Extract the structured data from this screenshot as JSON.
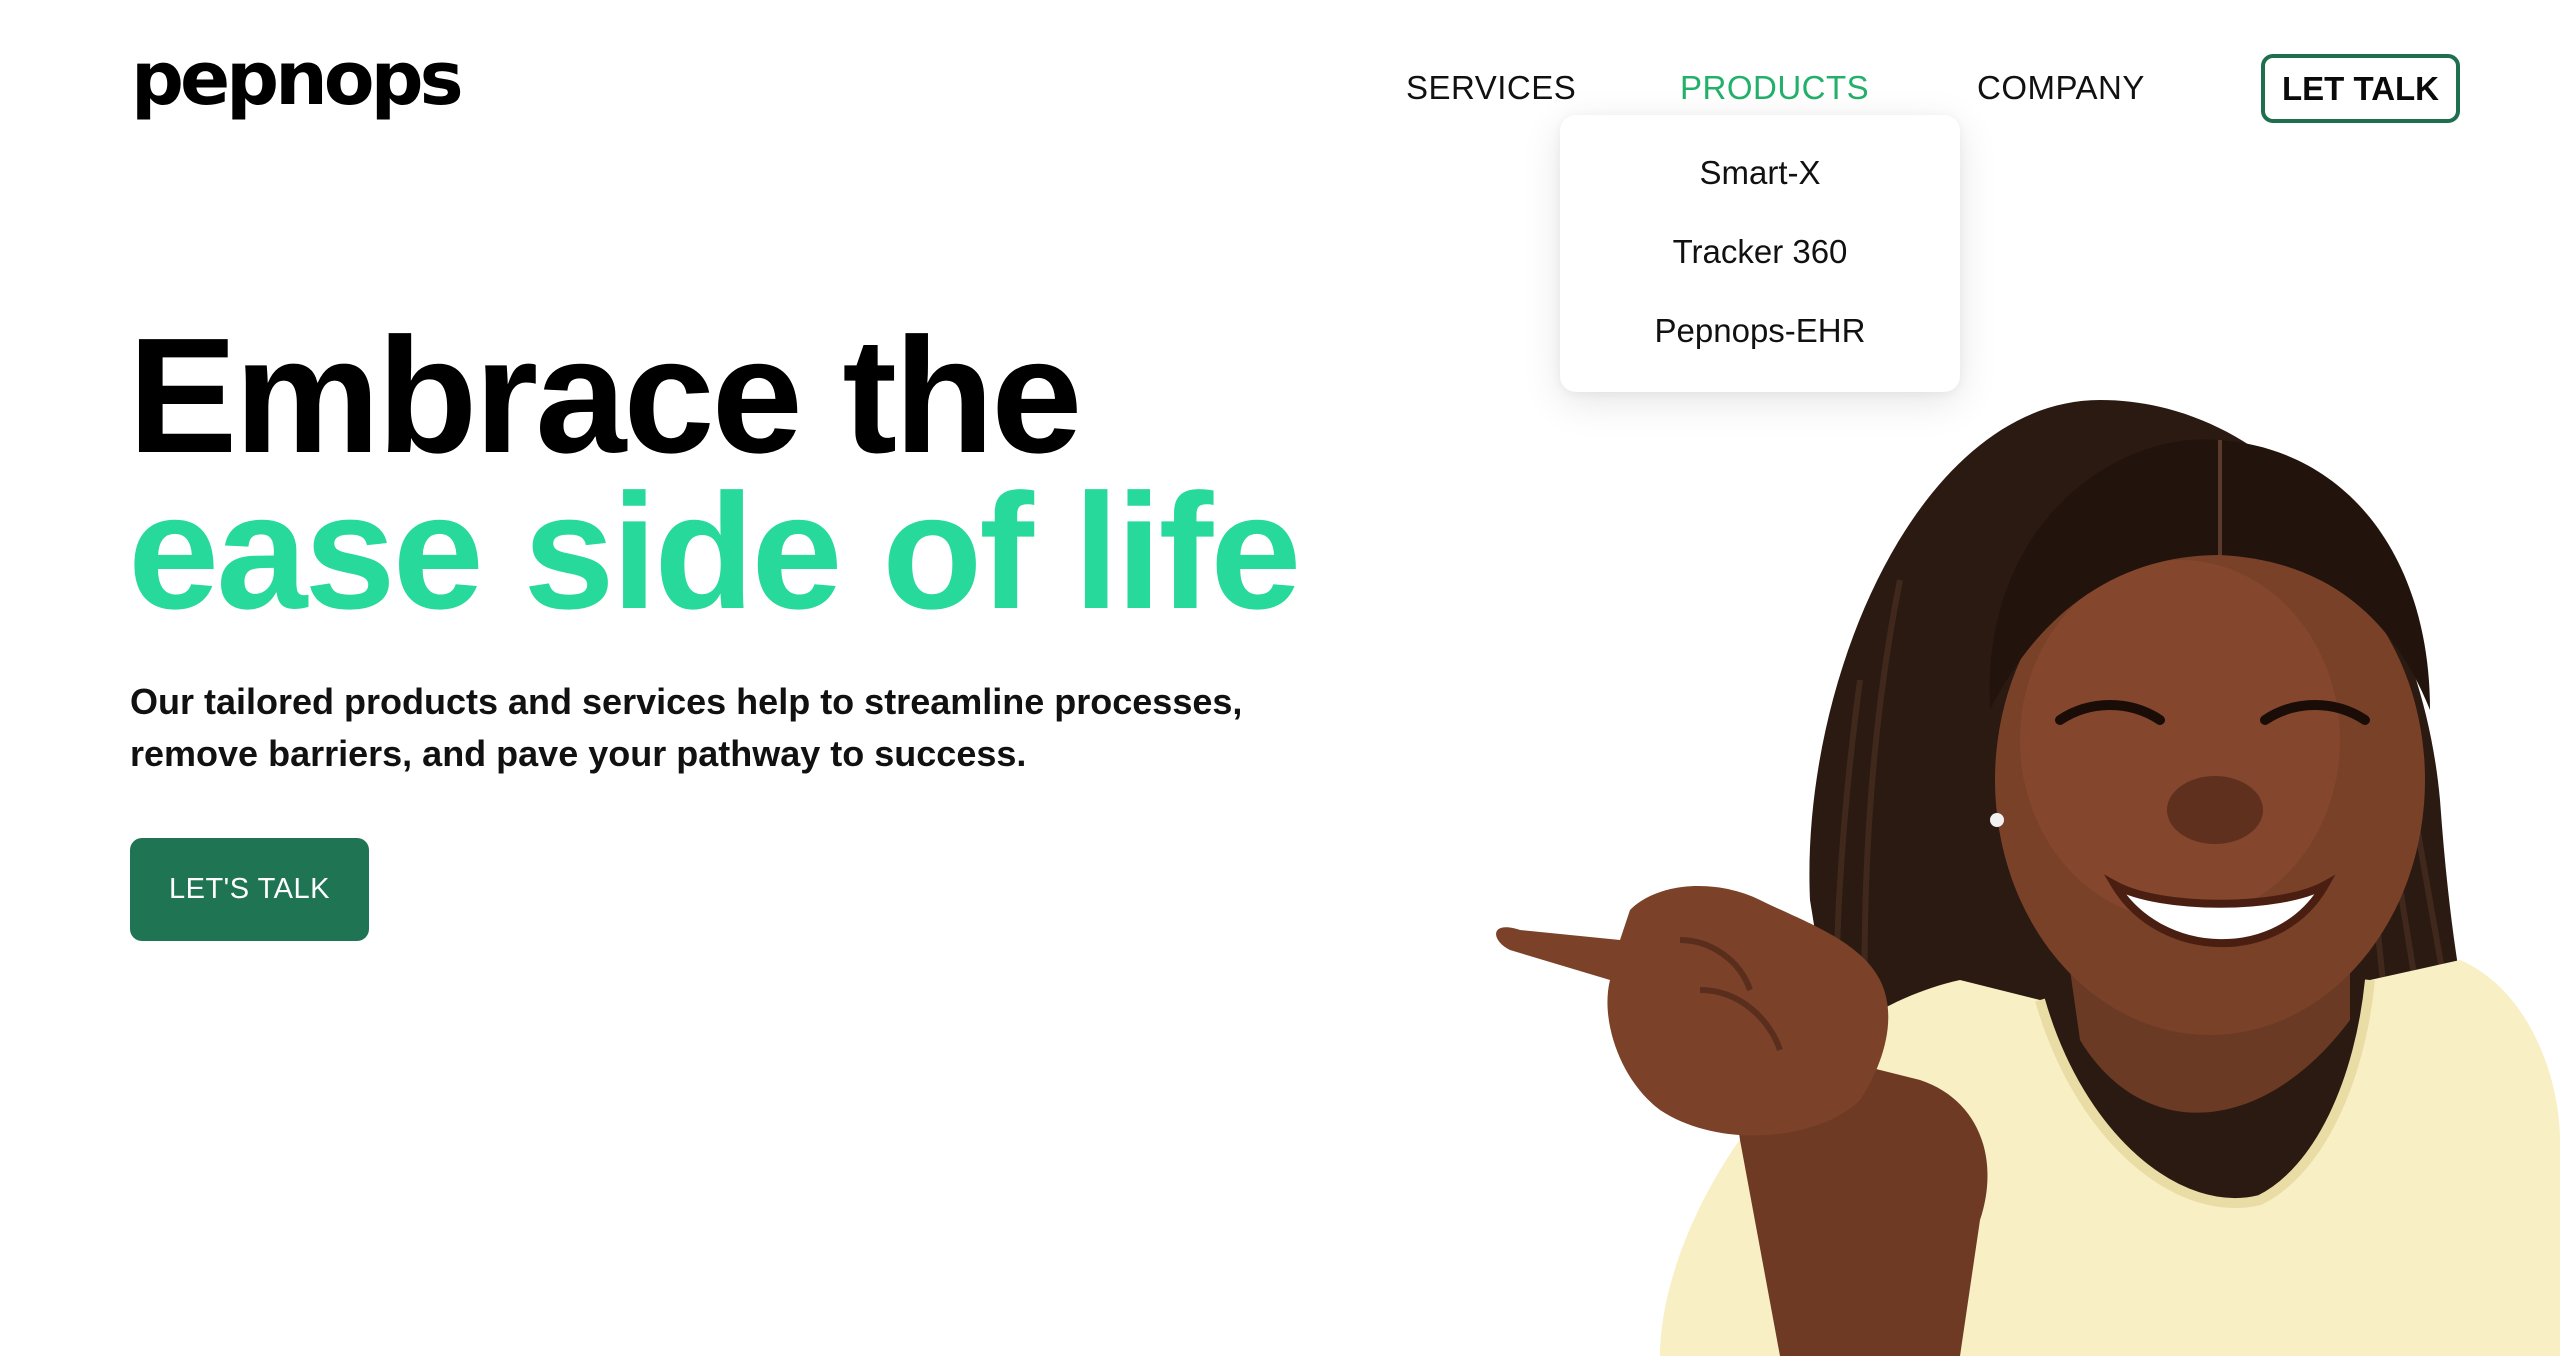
{
  "brand": {
    "logo_text": "pepnops",
    "accent_color": "#27d99b",
    "nav_active_color": "#23b06a",
    "button_color": "#1f7454"
  },
  "nav": {
    "items": [
      {
        "label": "SERVICES",
        "active": false
      },
      {
        "label": "PRODUCTS",
        "active": true
      },
      {
        "label": "COMPANY",
        "active": false
      }
    ],
    "cta_label": "LET TALK"
  },
  "products_dropdown": {
    "open": true,
    "items": [
      {
        "label": "Smart-X"
      },
      {
        "label": "Tracker 360"
      },
      {
        "label": "Pepnops-EHR"
      }
    ]
  },
  "hero": {
    "headline_line1": "Embrace the",
    "headline_line2": "ease side of life",
    "subtext": "Our tailored products and services help to streamline processes, remove barriers, and pave your pathway to success.",
    "cta_label": "LET'S TALK"
  }
}
